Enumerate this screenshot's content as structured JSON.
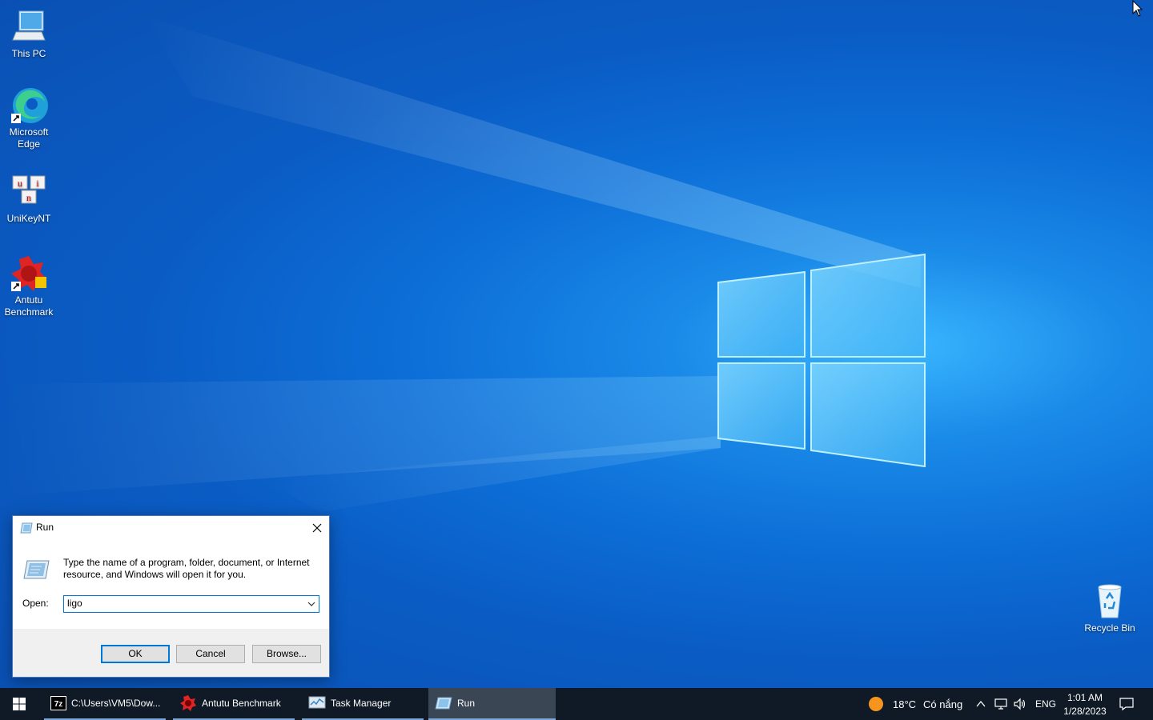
{
  "desktop": {
    "icons": [
      {
        "label": "This PC",
        "icon": "this-pc-icon"
      },
      {
        "label": "Microsoft Edge",
        "icon": "edge-icon"
      },
      {
        "label": "UniKeyNT",
        "icon": "unikey-icon"
      },
      {
        "label": "Antutu Benchmark",
        "icon": "antutu-icon"
      },
      {
        "label": "Recycle Bin",
        "icon": "recycle-bin-icon"
      }
    ],
    "unikey_letters": [
      "u",
      "i",
      "n"
    ]
  },
  "run_dialog": {
    "title": "Run",
    "description": "Type the name of a program, folder, document, or Internet resource, and Windows will open it for you.",
    "open_label": "Open:",
    "open_value": "ligo",
    "ok_label": "OK",
    "cancel_label": "Cancel",
    "browse_label": "Browse..."
  },
  "taskbar": {
    "apps": [
      {
        "label": "C:\\Users\\VM5\\Dow...",
        "icon": "7zip-icon",
        "badge": "7z",
        "active": false
      },
      {
        "label": "Antutu Benchmark",
        "icon": "antutu-icon",
        "active": false
      },
      {
        "label": "Task Manager",
        "icon": "task-manager-icon",
        "active": false
      },
      {
        "label": "Run",
        "icon": "run-icon",
        "active": true
      }
    ],
    "weather": {
      "temp": "18°C",
      "condition": "Có nắng",
      "icon": "sun-icon"
    },
    "language": "ENG",
    "time": "1:01 AM",
    "date": "1/28/2023"
  },
  "colors": {
    "accent": "#0078d7",
    "taskbar_bg": "#101a26",
    "active_app_bg": "#3a4654"
  }
}
